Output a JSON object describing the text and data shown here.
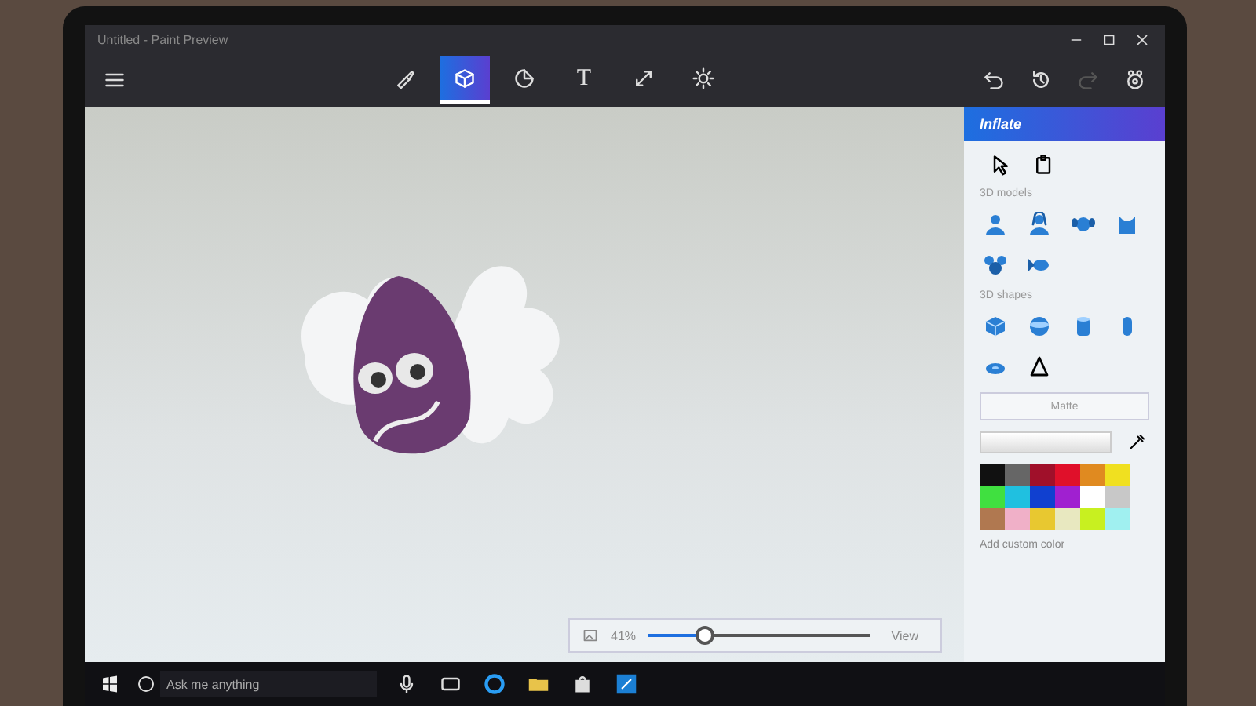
{
  "window": {
    "title": "Untitled - Paint Preview"
  },
  "toolbar": {
    "tools": [
      {
        "kind": "brush",
        "selected": false
      },
      {
        "kind": "cube",
        "selected": true
      },
      {
        "kind": "sticker",
        "selected": false
      },
      {
        "kind": "text",
        "glyph": "T",
        "selected": false
      },
      {
        "kind": "resize",
        "selected": false
      },
      {
        "kind": "effects",
        "selected": false
      }
    ],
    "actions": [
      {
        "kind": "undo",
        "disabled": false
      },
      {
        "kind": "history",
        "disabled": false
      },
      {
        "kind": "redo",
        "disabled": true
      },
      {
        "kind": "community",
        "disabled": false
      }
    ]
  },
  "panel": {
    "title": "Inflate",
    "select_tools": [
      {
        "kind": "select"
      },
      {
        "kind": "paste"
      }
    ],
    "models_heading": "3D models",
    "models": [
      {
        "kind": "man"
      },
      {
        "kind": "woman"
      },
      {
        "kind": "dog"
      },
      {
        "kind": "cat"
      },
      {
        "kind": "mouse"
      },
      {
        "kind": "fish"
      }
    ],
    "shapes_heading": "3D shapes",
    "shapes": [
      {
        "kind": "cube"
      },
      {
        "kind": "sphere"
      },
      {
        "kind": "cylinder"
      },
      {
        "kind": "capsule"
      },
      {
        "kind": "torus"
      },
      {
        "kind": "cone"
      }
    ],
    "material": "Matte",
    "palette": [
      {
        "color": "#111111"
      },
      {
        "color": "#666666"
      },
      {
        "color": "#a0102a"
      },
      {
        "color": "#e0102a"
      },
      {
        "color": "#e08a20"
      },
      {
        "color": "#f0e020"
      },
      {
        "color": "#40e040"
      },
      {
        "color": "#20c0e0"
      },
      {
        "color": "#1040d0"
      },
      {
        "color": "#a020d0"
      },
      {
        "color": "#ffffff"
      },
      {
        "color": "#c8c8c8"
      },
      {
        "color": "#b07850"
      },
      {
        "color": "#f0b0c8"
      },
      {
        "color": "#e8c830"
      },
      {
        "color": "#e8e8c0"
      },
      {
        "color": "#c8f020"
      },
      {
        "color": "#a0f0f0"
      }
    ],
    "add_color": "Add custom color"
  },
  "zoom": {
    "percent": "41%",
    "level": 0.3,
    "view": "View"
  },
  "taskbar": {
    "search_placeholder": "Ask me anything",
    "apps": [
      {
        "kind": "mic"
      },
      {
        "kind": "task-view"
      },
      {
        "kind": "browser"
      },
      {
        "kind": "folder"
      },
      {
        "kind": "store"
      },
      {
        "kind": "paint"
      }
    ]
  }
}
